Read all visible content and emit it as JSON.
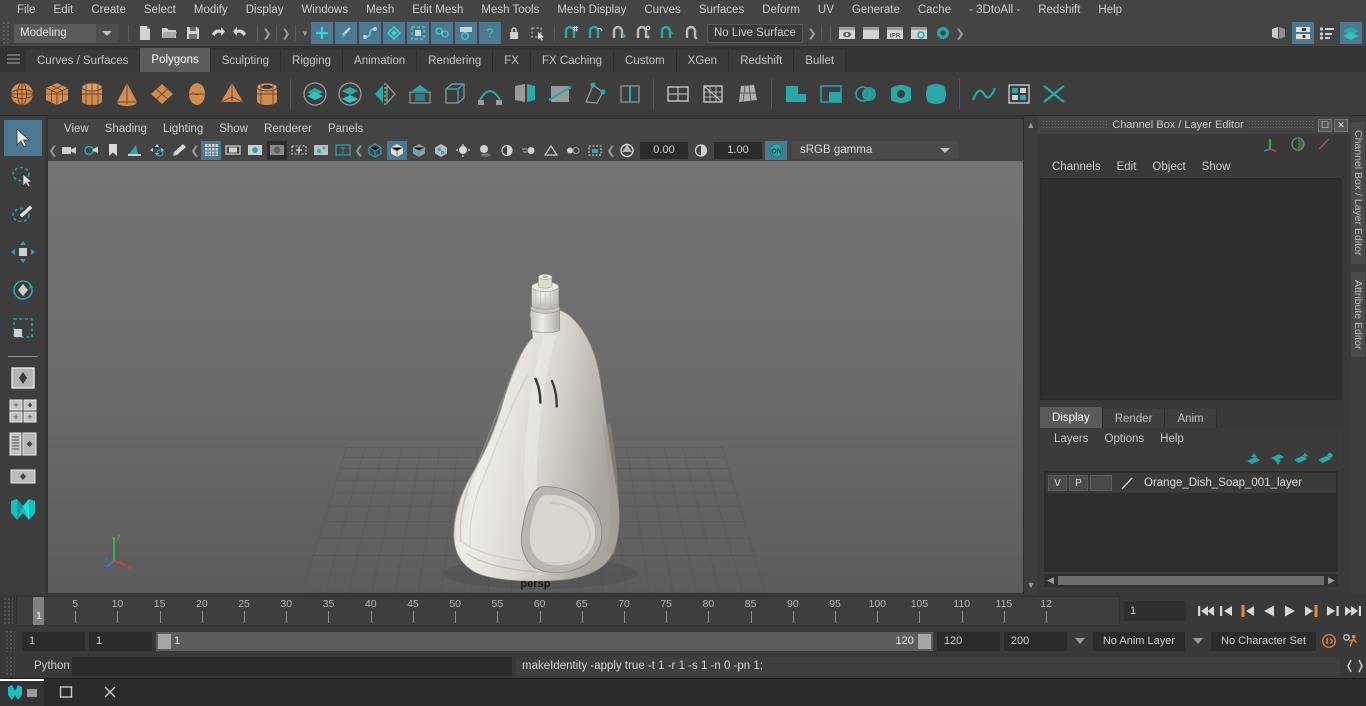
{
  "menubar": {
    "items": [
      "File",
      "Edit",
      "Create",
      "Select",
      "Modify",
      "Display",
      "Windows",
      "Mesh",
      "Edit Mesh",
      "Mesh Tools",
      "Mesh Display",
      "Curves",
      "Surfaces",
      "Deform",
      "UV",
      "Generate",
      "Cache",
      "- 3DtoAll -",
      "Redshift",
      "Help"
    ]
  },
  "statusline": {
    "menu_set": "Modeling",
    "live_surface": "No Live Surface",
    "icons": [
      "new-scene-icon",
      "open-scene-icon",
      "save-scene-icon",
      "undo-icon",
      "redo-icon",
      "select-by-hierarchy-icon",
      "select-by-object-icon",
      "select-by-component-icon",
      "modeling-mode-icon",
      "lock-selection-icon",
      "highlight-selection-icon",
      "snap-to-grid-icon",
      "snap-to-curve-icon",
      "snap-to-point-icon",
      "snap-to-projected-center-icon",
      "snap-to-view-plane-icon",
      "make-live-icon",
      "render-view-icon",
      "render-current-frame-icon",
      "ipr-render-icon",
      "render-settings-icon",
      "hypershade-icon",
      "show-hide-editors-icon",
      "channel-box-toggle-icon",
      "attribute-editor-toggle-icon",
      "tool-settings-toggle-icon"
    ]
  },
  "shelf": {
    "tabs": [
      "Curves / Surfaces",
      "Polygons",
      "Sculpting",
      "Rigging",
      "Animation",
      "Rendering",
      "FX",
      "FX Caching",
      "Custom",
      "XGen",
      "Redshift",
      "Bullet"
    ],
    "active_tab": "Polygons",
    "icons": [
      "poly-sphere-icon",
      "poly-cube-icon",
      "poly-cylinder-icon",
      "poly-cone-icon",
      "poly-plane-icon",
      "poly-torus-icon",
      "poly-pyramid-icon",
      "poly-pipe-icon",
      "combine-icon",
      "separate-icon",
      "mirror-icon",
      "extrude-icon",
      "bevel-icon",
      "bridge-icon",
      "append-polygon-icon",
      "multi-cut-icon",
      "target-weld-icon",
      "connect-icon",
      "quad-draw-icon",
      "smooth-icon",
      "retopologize-icon",
      "reduce-icon",
      "boolean-union-icon",
      "boolean-difference-icon",
      "boolean-intersection-icon",
      "fill-hole-icon",
      "circularize-icon",
      "symmetrize-icon",
      "poly-uv-icon",
      "crease-icon"
    ]
  },
  "toolbox": {
    "tools": [
      "select-tool",
      "lasso-select-tool",
      "paint-select-tool",
      "move-tool",
      "rotate-tool",
      "scale-tool"
    ],
    "selected": "select-tool",
    "layouts": [
      "single-perspective-layout",
      "four-view-layout",
      "outliner-persp-layout",
      "hypergraph-persp-layout",
      "persp-graph-layout"
    ]
  },
  "viewport": {
    "menus": [
      "View",
      "Shading",
      "Lighting",
      "Show",
      "Renderer",
      "Panels"
    ],
    "exposure": "0.00",
    "gamma": "1.00",
    "color_space": "sRGB gamma",
    "view_label": "persp",
    "toolbar_icons": [
      "select-camera-icon",
      "camera-attributes-icon",
      "bookmark-icon",
      "image-plane-icon",
      "two-d-pan-zoom-icon",
      "grease-pencil-icon",
      "grid-toggle-icon",
      "film-gate-icon",
      "resolution-gate-icon",
      "gate-mask-icon",
      "film-origin-icon",
      "xray-joints-icon",
      "texture-borders-icon",
      "wireframe-shading-icon",
      "smooth-shade-all-icon",
      "wireframe-on-shaded-icon",
      "textured-icon",
      "use-all-lights-icon",
      "shadows-icon",
      "ambient-occlusion-icon",
      "motion-blur-icon",
      "multisample-icon",
      "depth-of-field-icon",
      "isolate-select-icon",
      "exposure-icon",
      "gamma-icon",
      "view-transform-enabled-icon"
    ],
    "axis_labels": [
      "y",
      "z",
      "x"
    ]
  },
  "channel_box": {
    "panel_title": "Channel Box / Layer Editor",
    "menus": [
      "Channels",
      "Edit",
      "Object",
      "Show"
    ],
    "side_tabs": [
      "Channel Box / Layer Editor",
      "Attribute Editor"
    ]
  },
  "layer_editor": {
    "tabs": [
      "Display",
      "Render",
      "Anim"
    ],
    "active_tab": "Display",
    "menus": [
      "Layers",
      "Options",
      "Help"
    ],
    "buttons": [
      "move-layer-up-icon",
      "move-layer-down-icon",
      "create-empty-layer-icon",
      "create-layer-from-selected-icon"
    ],
    "layers": [
      {
        "visibility": "V",
        "playback": "P",
        "shading": "",
        "name": "Orange_Dish_Soap_001_layer"
      }
    ]
  },
  "time_slider": {
    "tick_labels": [
      "5",
      "10",
      "15",
      "20",
      "25",
      "30",
      "35",
      "40",
      "45",
      "50",
      "55",
      "60",
      "65",
      "70",
      "75",
      "80",
      "85",
      "90",
      "95",
      "100",
      "105",
      "110",
      "115",
      "12"
    ],
    "current_frame": "1",
    "frame_field": "1",
    "transport": [
      "go-to-start-icon",
      "step-back-keyframe-icon",
      "step-back-frame-icon",
      "play-backwards-icon",
      "play-forwards-icon",
      "step-forward-frame-icon",
      "step-forward-keyframe-icon",
      "go-to-end-icon"
    ]
  },
  "range_slider": {
    "anim_start": "1",
    "range_start": "1",
    "range_bar_start": "1",
    "range_bar_end": "120",
    "range_end": "120",
    "anim_end": "200",
    "anim_layer": "No Anim Layer",
    "character_set": "No Character Set",
    "icons": [
      "auto-keyframe-icon",
      "animation-preferences-icon"
    ]
  },
  "command_line": {
    "language": "Python",
    "input_value": "",
    "output": "makeIdentity -apply true -t 1 -r 1 -s 1 -n 0 -pn 1;",
    "script_editor_icon": "script-editor-icon"
  },
  "taskbar": {
    "items": [
      "maya-app-icon",
      "window-icon",
      "close-icon"
    ]
  },
  "colors": {
    "accent_blue": "#4c7891",
    "teal": "#2aa8a8",
    "orange": "#d98c4a",
    "panel_bg": "#393939",
    "menu_bg": "#444444",
    "viewport_bg": "#6a6a6a"
  }
}
